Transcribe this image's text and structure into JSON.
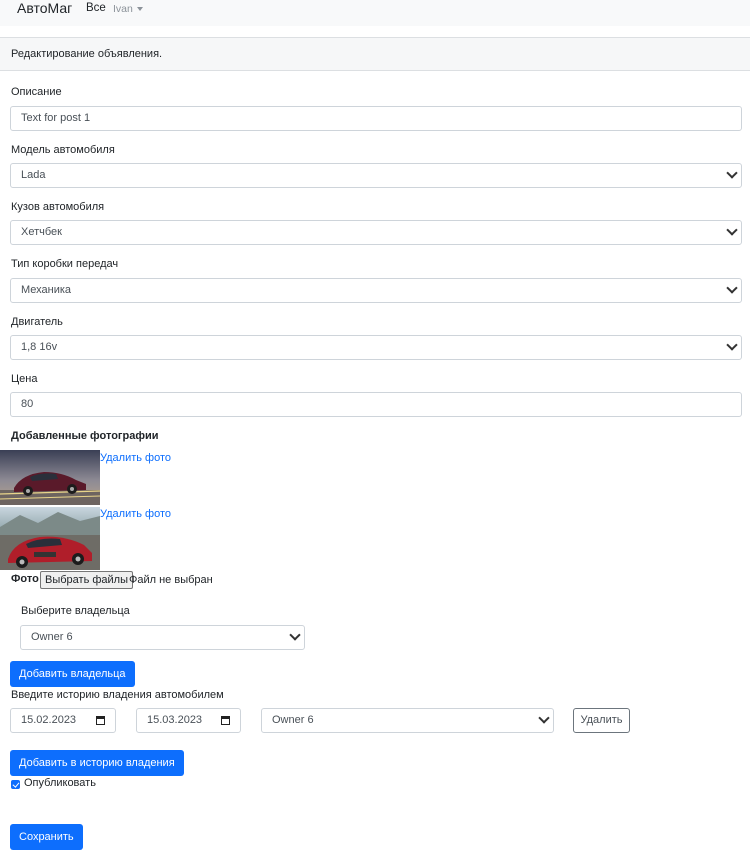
{
  "navbar": {
    "brand": "АвтоМаг",
    "all": "Все",
    "user": "Ivan"
  },
  "card": {
    "header": "Редактирование объявления."
  },
  "form": {
    "description": {
      "label": "Описание",
      "value": "Text for post 1"
    },
    "model": {
      "label": "Модель автомобиля",
      "value": "Lada"
    },
    "body": {
      "label": "Кузов автомобиля",
      "value": "Хетчбек"
    },
    "gearbox": {
      "label": "Тип коробки передач",
      "value": "Механика"
    },
    "engine": {
      "label": "Двигатель",
      "value": "1,8 16v"
    },
    "price": {
      "label": "Цена",
      "value": "80"
    }
  },
  "photos": {
    "title": "Добавленные фотографии",
    "delete_label": "Удалить фото",
    "colors": {
      "car1": "#5a1a2a",
      "car2": "#b01e2a"
    }
  },
  "file_input": {
    "label": "Фото",
    "button": "Выбрать файлы",
    "status": "Файл не выбран"
  },
  "owner": {
    "label": "Выберите владельца",
    "value": "Owner 6",
    "add_button": "Добавить владельца"
  },
  "history": {
    "label": "Введите историю владения автомобилем",
    "date_from": "15.02.2023",
    "date_to": "15.03.2023",
    "owner": "Owner 6",
    "delete_button": "Удалить",
    "add_button": "Добавить в историю владения"
  },
  "publish": {
    "label": "Опубликовать",
    "checked": true
  },
  "save_button": "Сохранить",
  "colors": {
    "primary": "#0d6efd",
    "link": "#0d6efd"
  }
}
